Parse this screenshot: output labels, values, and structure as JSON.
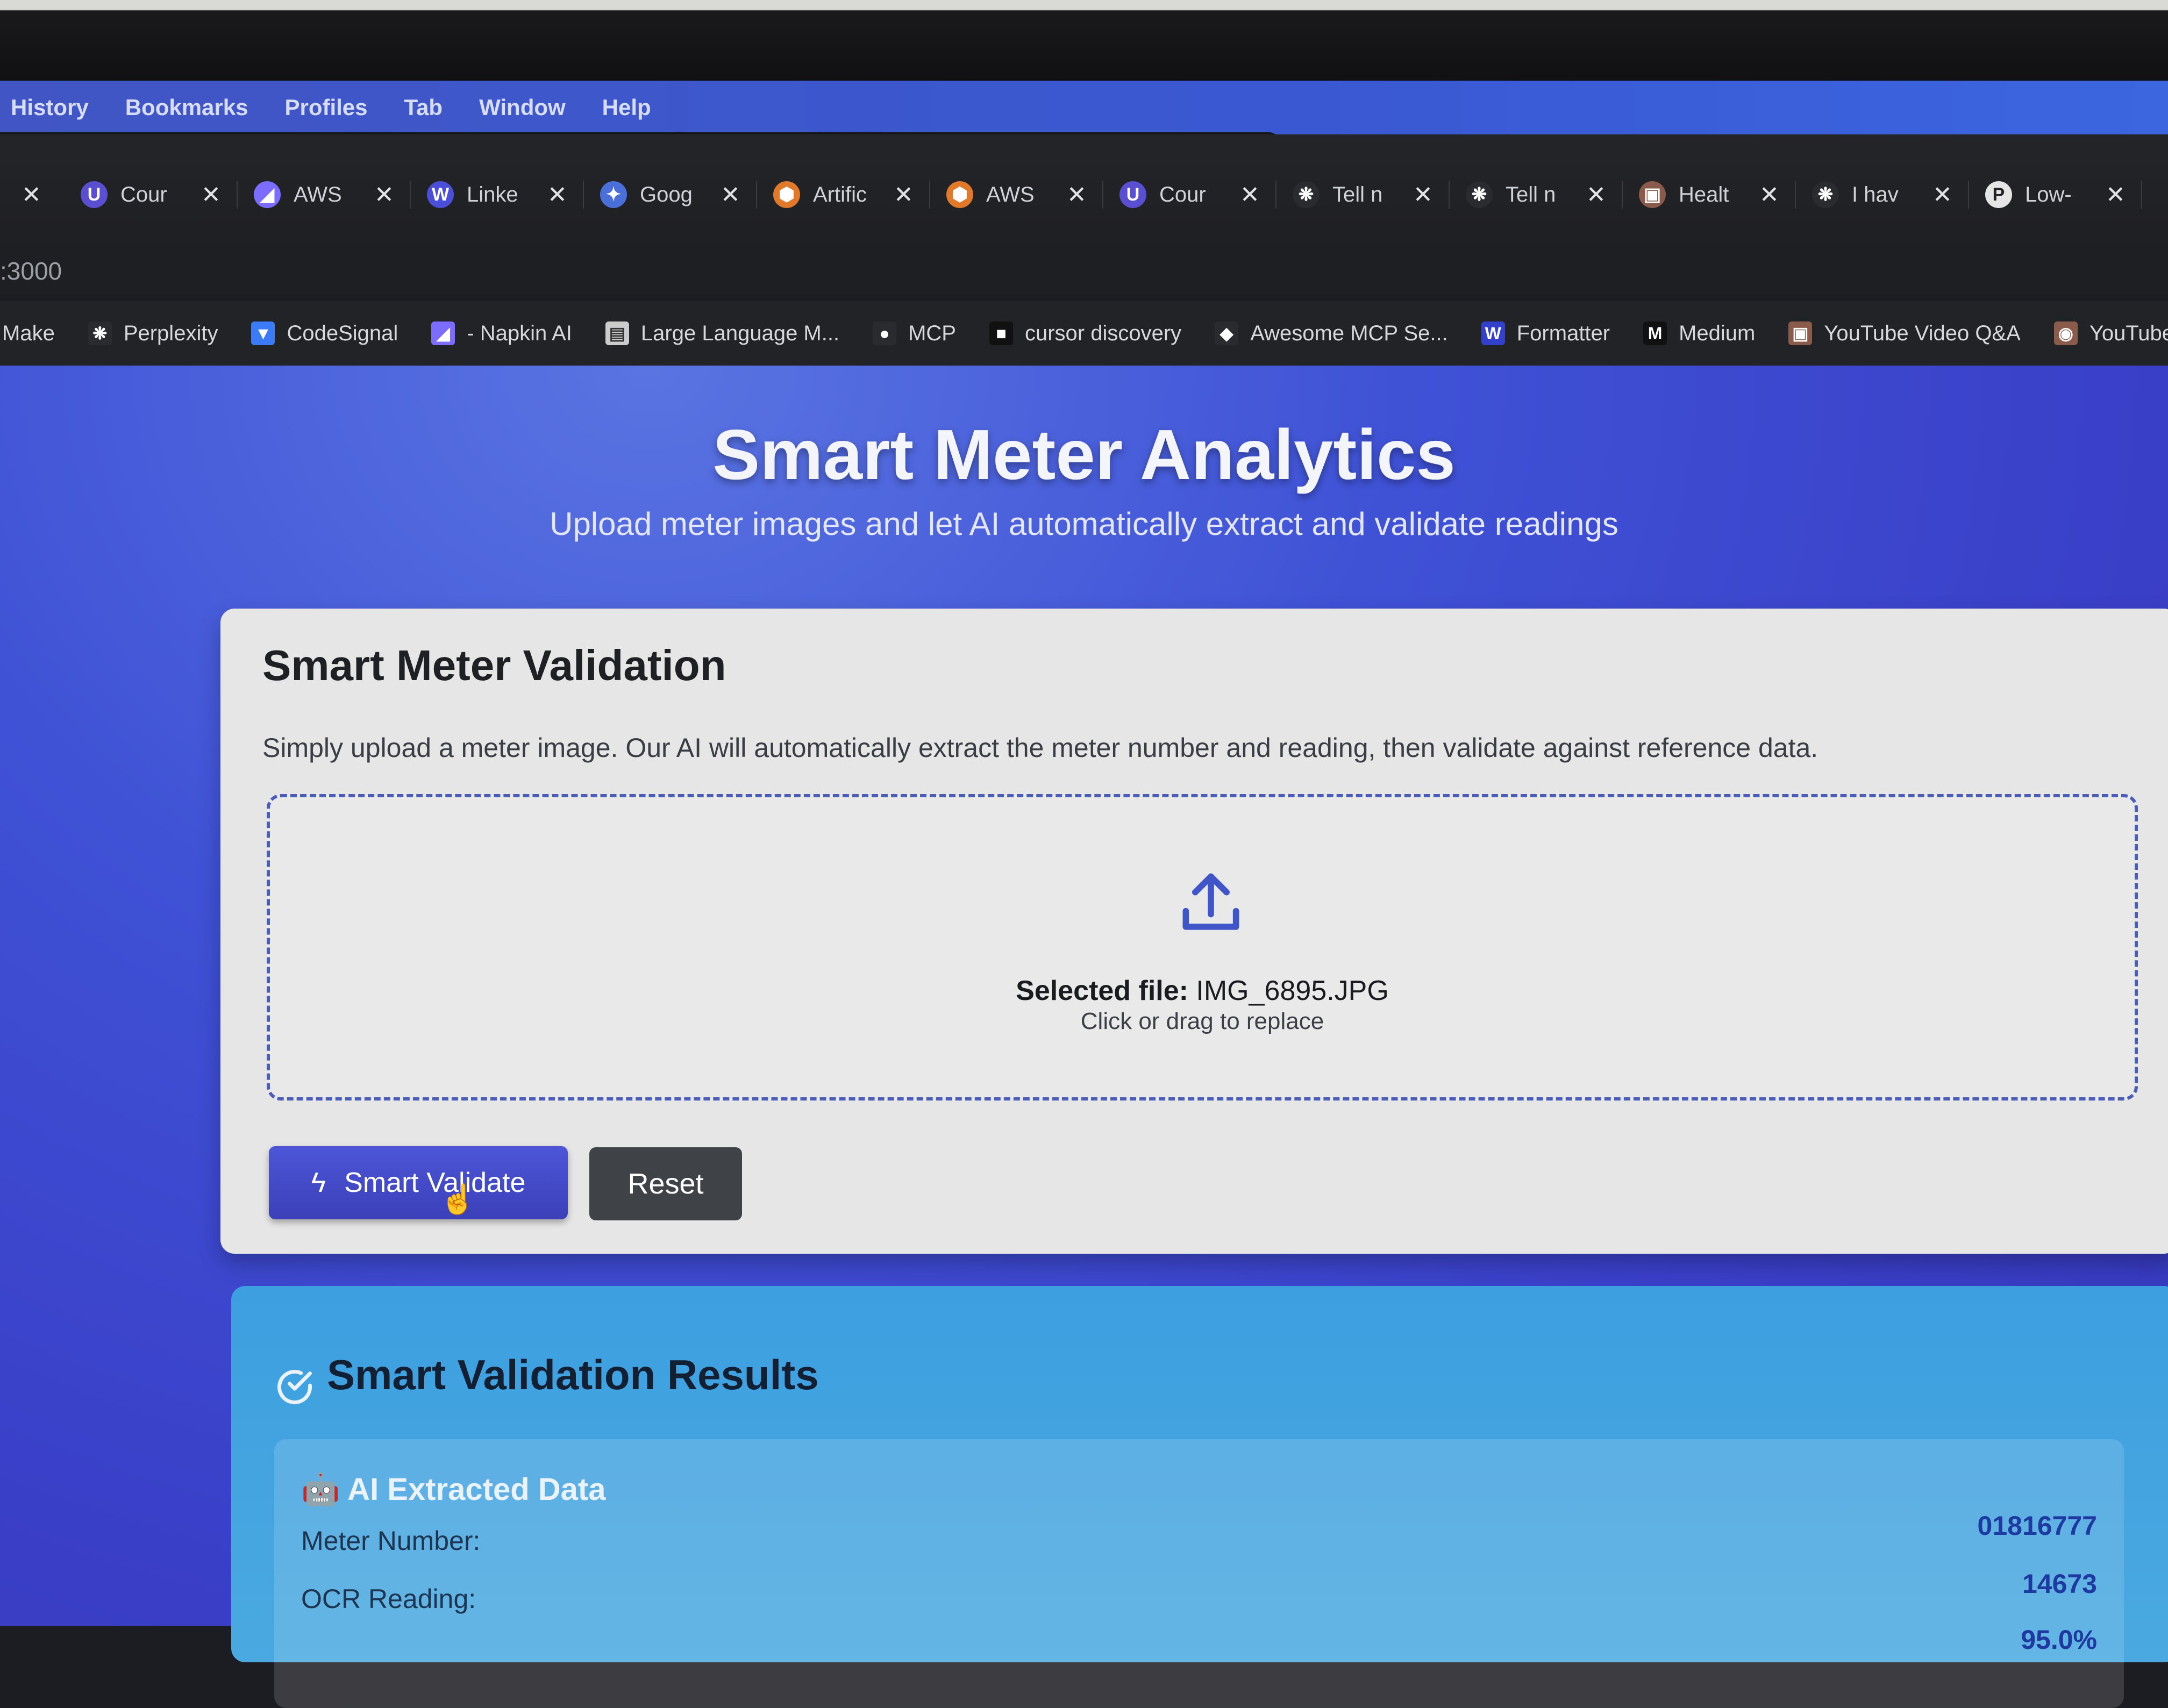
{
  "menubar": [
    "History",
    "Bookmarks",
    "Profiles",
    "Tab",
    "Window",
    "Help"
  ],
  "tabs": [
    {
      "label": "Cour",
      "icon": "shield-logo-icon",
      "color": "#5a4fd1",
      "glyph": "U"
    },
    {
      "label": "AWS",
      "icon": "napkin-logo-icon",
      "color": "#7c6cff",
      "glyph": "◢"
    },
    {
      "label": "Linke",
      "icon": "w-logo-icon",
      "color": "#4b4fd8",
      "glyph": "W"
    },
    {
      "label": "Goog",
      "icon": "gemini-logo-icon",
      "color": "#4a6fd8",
      "glyph": "✦"
    },
    {
      "label": "Artific",
      "icon": "aws-cube-icon",
      "color": "#e07a2a",
      "glyph": "⬢"
    },
    {
      "label": "AWS",
      "icon": "aws-cube-icon",
      "color": "#e07a2a",
      "glyph": "⬢"
    },
    {
      "label": "Cour",
      "icon": "shield-logo-icon",
      "color": "#5a4fd1",
      "glyph": "U"
    },
    {
      "label": "Tell n",
      "icon": "openai-logo-icon",
      "color": "#2a2b2e",
      "glyph": "❋"
    },
    {
      "label": "Tell n",
      "icon": "openai-logo-icon",
      "color": "#2a2b2e",
      "glyph": "❋"
    },
    {
      "label": "Healt",
      "icon": "robot-icon",
      "color": "#8a5a4a",
      "glyph": "▣"
    },
    {
      "label": "I hav",
      "icon": "openai-logo-icon",
      "color": "#2a2b2e",
      "glyph": "❋"
    },
    {
      "label": "Low-",
      "icon": "pkp-logo-icon",
      "color": "#e5e5e5",
      "glyph": "P"
    }
  ],
  "address": ":3000",
  "bookmarks": [
    {
      "label": "Make",
      "icon": "",
      "color": "#000000",
      "glyph": ""
    },
    {
      "label": "Perplexity",
      "icon": "openai-logo-icon",
      "color": "#2a2b2e",
      "glyph": "❋"
    },
    {
      "label": "CodeSignal",
      "icon": "codesignal-logo-icon",
      "color": "#3b7bf5",
      "glyph": "▼"
    },
    {
      "label": "- Napkin AI",
      "icon": "napkin-logo-icon",
      "color": "#7c6cff",
      "glyph": "◢"
    },
    {
      "label": "Large Language M...",
      "icon": "doc-thumbnail-icon",
      "color": "#cccccc",
      "glyph": "▤"
    },
    {
      "label": "MCP",
      "icon": "github-icon",
      "color": "#2a2b2e",
      "glyph": "●"
    },
    {
      "label": "cursor discovery",
      "icon": "square-icon",
      "color": "#111111",
      "glyph": "■"
    },
    {
      "label": "Awesome MCP Se...",
      "icon": "glama-logo-icon",
      "color": "#2a2b2e",
      "glyph": "◆"
    },
    {
      "label": "Formatter",
      "icon": "w-logo-icon",
      "color": "#3340cc",
      "glyph": "W"
    },
    {
      "label": "Medium",
      "icon": "medium-logo-icon",
      "color": "#111111",
      "glyph": "M"
    },
    {
      "label": "YouTube Video Q&A",
      "icon": "robot-icon",
      "color": "#8a5a4a",
      "glyph": "▣"
    },
    {
      "label": "YouTube Vide",
      "icon": "robot-icon",
      "color": "#8a5a4a",
      "glyph": "◉"
    }
  ],
  "hero": {
    "title": "Smart Meter Analytics",
    "subtitle": "Upload meter images and let AI automatically extract and validate readings"
  },
  "validation_card": {
    "title": "Smart Meter Validation",
    "description": "Simply upload a meter image. Our AI will automatically extract the meter number and reading, then validate against reference data.",
    "selected_label": "Selected file:",
    "selected_file": "IMG_6895.JPG",
    "hint": "Click or drag to replace",
    "smart_validate_label": "Smart Validate",
    "reset_label": "Reset"
  },
  "results": {
    "title": "Smart Validation Results",
    "extracted_heading": "🤖 AI Extracted Data",
    "meter_number_label": "Meter Number:",
    "meter_number_value": "01816777",
    "ocr_reading_label": "OCR Reading:",
    "ocr_reading_value": "14673",
    "confidence_value": "95.0%"
  },
  "colors": {
    "accent": "#3f52d6",
    "button_primary": "#4148c4",
    "button_secondary": "#3f4247",
    "results_bg": "#44a4e0"
  }
}
